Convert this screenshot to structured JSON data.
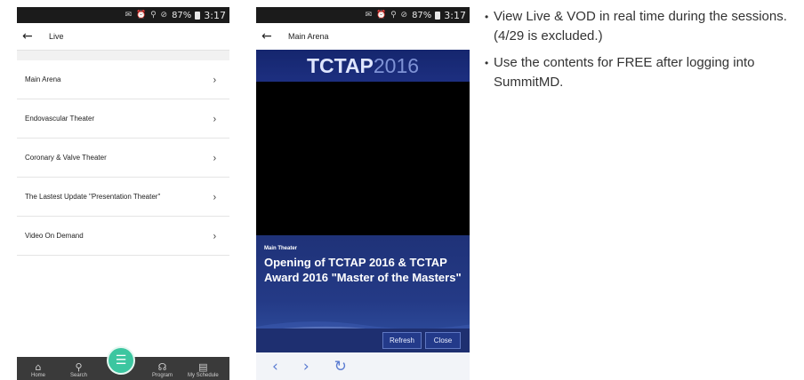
{
  "status_bar": {
    "time": "3:17",
    "signal": "87%"
  },
  "left_screen": {
    "title": "Live",
    "menu": [
      {
        "label": "Main Arena"
      },
      {
        "label": "Endovascular Theater"
      },
      {
        "label": "Coronary & Valve Theater"
      },
      {
        "label": "The Lastest Update \"Presentation Theater\""
      },
      {
        "label": "Video On Demand"
      }
    ],
    "nav": {
      "home": "Home",
      "search": "Search",
      "program": "Program",
      "schedule": "My Schedule"
    },
    "fab_icon": "menu-icon",
    "accent": "#3cc6a0"
  },
  "right_screen": {
    "title": "Main Arena",
    "banner": {
      "part1": "TCTAP",
      "part2": "2016"
    },
    "session": {
      "label": "Main Theater",
      "title": "Opening of TCTAP 2016 & TCTAP Award 2016 \"Master of the Masters\""
    },
    "buttons": {
      "refresh": "Refresh",
      "close": "Close"
    },
    "browser": {
      "back": "back-icon",
      "forward": "forward-icon",
      "reload": "reload-icon"
    },
    "brand_color": "#1d2f80"
  },
  "bullets": [
    "View Live & VOD in real time during the sessions. (4/29 is excluded.)",
    "Use the contents for FREE after logging into SummitMD."
  ]
}
